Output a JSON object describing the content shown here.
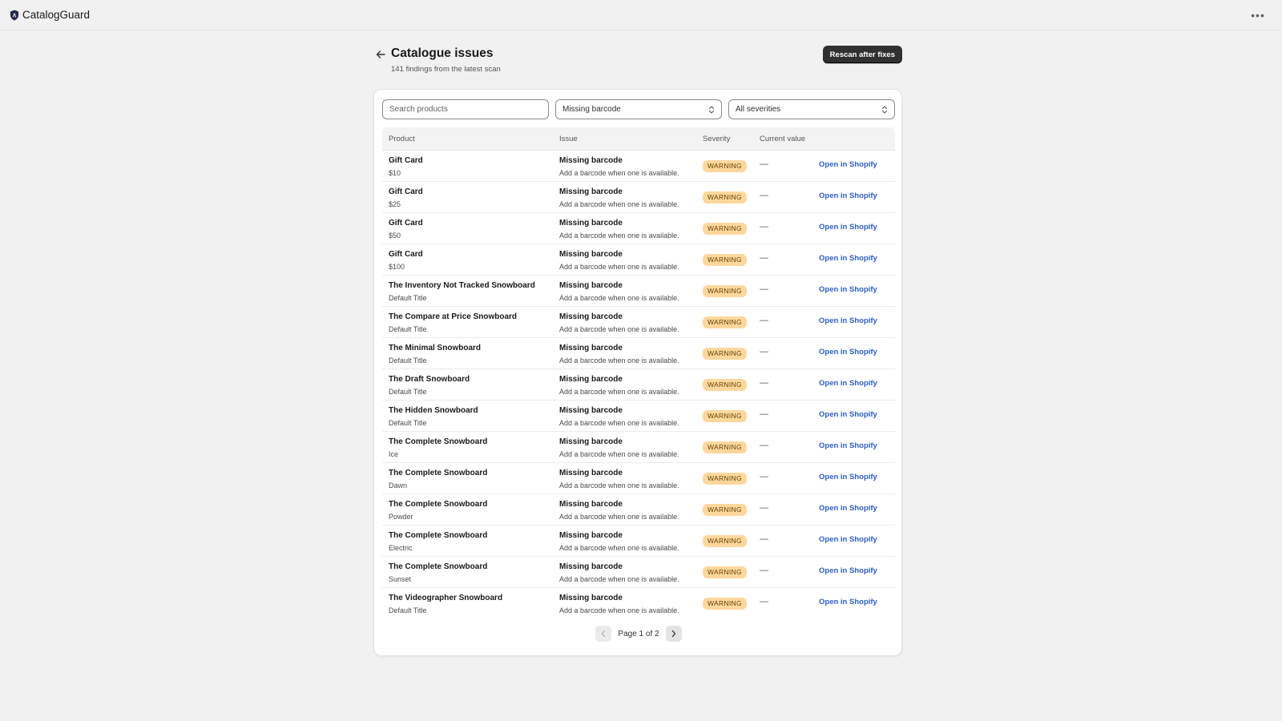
{
  "app": {
    "name": "CatalogGuard",
    "more_icon": "more-horizontal-icon"
  },
  "header": {
    "title": "Catalogue issues",
    "subtitle": "141 findings from the latest scan",
    "rescan_label": "Rescan after fixes"
  },
  "filters": {
    "search_placeholder": "Search products",
    "issue_value": "Missing barcode",
    "severity_value": "All severities"
  },
  "table": {
    "columns": {
      "product": "Product",
      "issue": "Issue",
      "severity": "Severity",
      "current_value": "Current value"
    },
    "rows": [
      {
        "name": "Gift Card",
        "variant": "$10",
        "issue": "Missing barcode",
        "desc": "Add a barcode when one is available.",
        "severity": "WARNING",
        "current": "—",
        "action": "Open in Shopify"
      },
      {
        "name": "Gift Card",
        "variant": "$25",
        "issue": "Missing barcode",
        "desc": "Add a barcode when one is available.",
        "severity": "WARNING",
        "current": "—",
        "action": "Open in Shopify"
      },
      {
        "name": "Gift Card",
        "variant": "$50",
        "issue": "Missing barcode",
        "desc": "Add a barcode when one is available.",
        "severity": "WARNING",
        "current": "—",
        "action": "Open in Shopify"
      },
      {
        "name": "Gift Card",
        "variant": "$100",
        "issue": "Missing barcode",
        "desc": "Add a barcode when one is available.",
        "severity": "WARNING",
        "current": "—",
        "action": "Open in Shopify"
      },
      {
        "name": "The Inventory Not Tracked Snowboard",
        "variant": "Default Title",
        "issue": "Missing barcode",
        "desc": "Add a barcode when one is available.",
        "severity": "WARNING",
        "current": "—",
        "action": "Open in Shopify"
      },
      {
        "name": "The Compare at Price Snowboard",
        "variant": "Default Title",
        "issue": "Missing barcode",
        "desc": "Add a barcode when one is available.",
        "severity": "WARNING",
        "current": "—",
        "action": "Open in Shopify"
      },
      {
        "name": "The Minimal Snowboard",
        "variant": "Default Title",
        "issue": "Missing barcode",
        "desc": "Add a barcode when one is available.",
        "severity": "WARNING",
        "current": "—",
        "action": "Open in Shopify"
      },
      {
        "name": "The Draft Snowboard",
        "variant": "Default Title",
        "issue": "Missing barcode",
        "desc": "Add a barcode when one is available.",
        "severity": "WARNING",
        "current": "—",
        "action": "Open in Shopify"
      },
      {
        "name": "The Hidden Snowboard",
        "variant": "Default Title",
        "issue": "Missing barcode",
        "desc": "Add a barcode when one is available.",
        "severity": "WARNING",
        "current": "—",
        "action": "Open in Shopify"
      },
      {
        "name": "The Complete Snowboard",
        "variant": "Ice",
        "issue": "Missing barcode",
        "desc": "Add a barcode when one is available.",
        "severity": "WARNING",
        "current": "—",
        "action": "Open in Shopify"
      },
      {
        "name": "The Complete Snowboard",
        "variant": "Dawn",
        "issue": "Missing barcode",
        "desc": "Add a barcode when one is available.",
        "severity": "WARNING",
        "current": "—",
        "action": "Open in Shopify"
      },
      {
        "name": "The Complete Snowboard",
        "variant": "Powder",
        "issue": "Missing barcode",
        "desc": "Add a barcode when one is available.",
        "severity": "WARNING",
        "current": "—",
        "action": "Open in Shopify"
      },
      {
        "name": "The Complete Snowboard",
        "variant": "Electric",
        "issue": "Missing barcode",
        "desc": "Add a barcode when one is available.",
        "severity": "WARNING",
        "current": "—",
        "action": "Open in Shopify"
      },
      {
        "name": "The Complete Snowboard",
        "variant": "Sunset",
        "issue": "Missing barcode",
        "desc": "Add a barcode when one is available.",
        "severity": "WARNING",
        "current": "—",
        "action": "Open in Shopify"
      },
      {
        "name": "The Videographer Snowboard",
        "variant": "Default Title",
        "issue": "Missing barcode",
        "desc": "Add a barcode when one is available.",
        "severity": "WARNING",
        "current": "—",
        "action": "Open in Shopify"
      }
    ]
  },
  "pagination": {
    "label": "Page 1 of 2"
  },
  "colors": {
    "warning_badge": "#ffd79d",
    "link": "#2c5fc7",
    "primary_button": "#303030"
  }
}
